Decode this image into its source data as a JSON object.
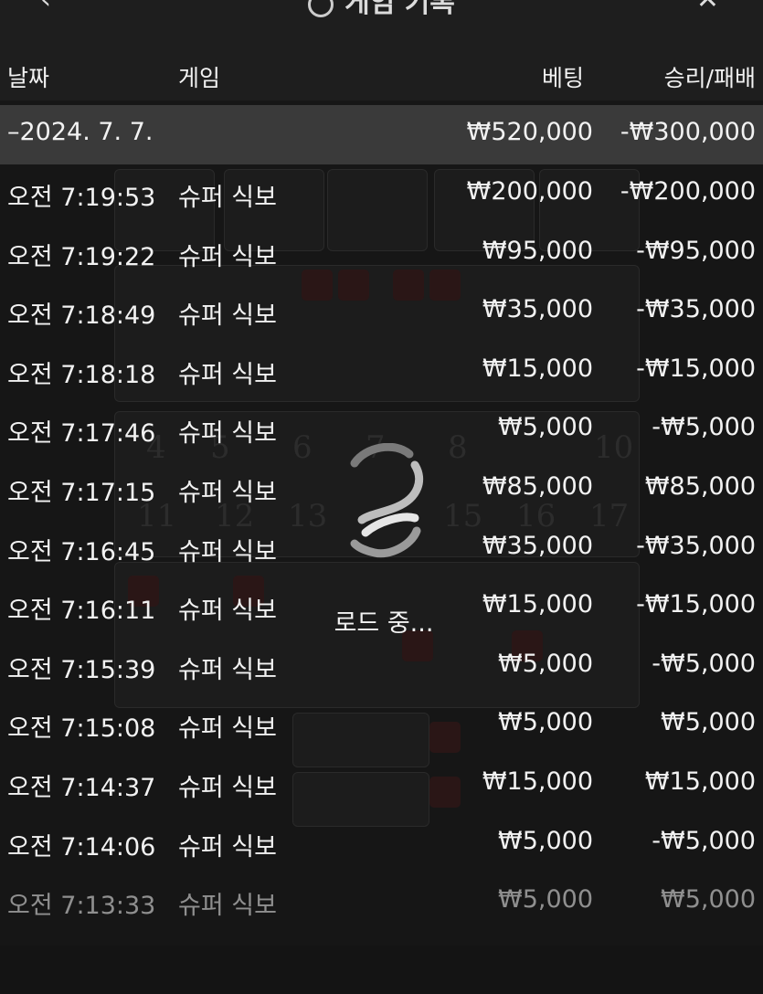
{
  "header": {
    "back_icon": "chevron-left-icon",
    "title": "게임 기록",
    "close_icon": "close-icon"
  },
  "columns": {
    "date": "날짜",
    "game": "게임",
    "bet": "베팅",
    "win_loss": "승리/패배"
  },
  "summary": {
    "date": "–2024. 7. 7.",
    "bet": "₩520,000",
    "win_loss": "-₩300,000"
  },
  "rows": [
    {
      "time": "오전 7:19:53",
      "game": "슈퍼 식보",
      "bet": "₩200,000",
      "win_loss": "-₩200,000"
    },
    {
      "time": "오전 7:19:22",
      "game": "슈퍼 식보",
      "bet": "₩95,000",
      "win_loss": "-₩95,000"
    },
    {
      "time": "오전 7:18:49",
      "game": "슈퍼 식보",
      "bet": "₩35,000",
      "win_loss": "-₩35,000"
    },
    {
      "time": "오전 7:18:18",
      "game": "슈퍼 식보",
      "bet": "₩15,000",
      "win_loss": "-₩15,000"
    },
    {
      "time": "오전 7:17:46",
      "game": "슈퍼 식보",
      "bet": "₩5,000",
      "win_loss": "-₩5,000"
    },
    {
      "time": "오전 7:17:15",
      "game": "슈퍼 식보",
      "bet": "₩85,000",
      "win_loss": "₩85,000"
    },
    {
      "time": "오전 7:16:45",
      "game": "슈퍼 식보",
      "bet": "₩35,000",
      "win_loss": "-₩35,000"
    },
    {
      "time": "오전 7:16:11",
      "game": "슈퍼 식보",
      "bet": "₩15,000",
      "win_loss": "-₩15,000"
    },
    {
      "time": "오전 7:15:39",
      "game": "슈퍼 식보",
      "bet": "₩5,000",
      "win_loss": "-₩5,000"
    },
    {
      "time": "오전 7:15:08",
      "game": "슈퍼 식보",
      "bet": "₩5,000",
      "win_loss": "₩5,000"
    },
    {
      "time": "오전 7:14:37",
      "game": "슈퍼 식보",
      "bet": "₩15,000",
      "win_loss": "₩15,000"
    },
    {
      "time": "오전 7:14:06",
      "game": "슈퍼 식보",
      "bet": "₩5,000",
      "win_loss": "-₩5,000"
    },
    {
      "time": "오전 7:13:33",
      "game": "슈퍼 식보",
      "bet": "₩5,000",
      "win_loss": "₩5,000"
    }
  ],
  "loading": {
    "text": "로드 중...",
    "icon": "loading-spinner-icon"
  },
  "colors": {
    "background": "#161616",
    "summary_row": "#3a3a3a",
    "text": "#f2f2f2"
  }
}
